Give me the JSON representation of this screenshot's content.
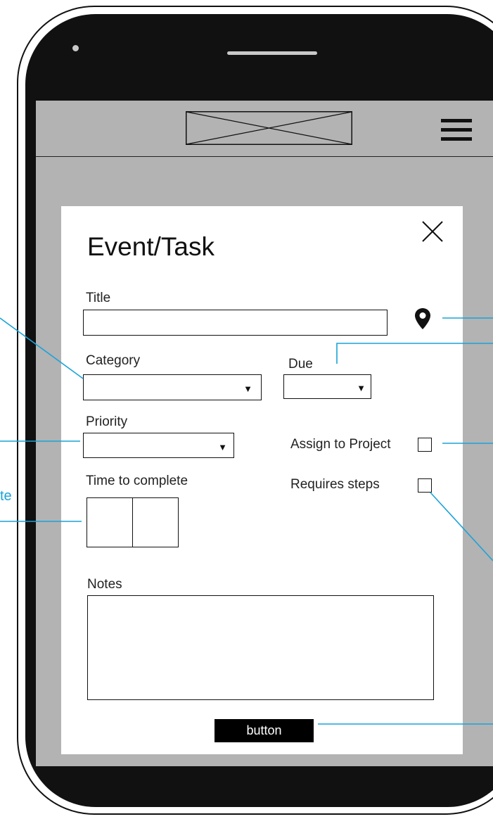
{
  "header": {
    "logo_icon": "image-placeholder-icon",
    "menu_icon": "hamburger-menu-icon"
  },
  "modal": {
    "title": "Event/Task",
    "close_icon": "close-icon",
    "fields": {
      "title_label": "Title",
      "title_value": "",
      "location_icon": "map-pin-icon",
      "category_label": "Category",
      "category_value": "",
      "due_label": "Due",
      "due_value": "",
      "priority_label": "Priority",
      "priority_value": "",
      "assign_project_label": "Assign to Project",
      "assign_project_checked": false,
      "time_label": "Time to complete",
      "requires_steps_label": "Requires steps",
      "requires_steps_checked": false,
      "notes_label": "Notes",
      "notes_value": ""
    },
    "dropdown_arrow": "▼",
    "button_label": "button"
  },
  "annotations": {
    "partial_text": "te",
    "color": "#1aa3d9"
  },
  "colors": {
    "phone_body": "#111111",
    "screen_bg": "#b3b3b3",
    "modal_bg": "#ffffff",
    "button_bg": "#000000"
  }
}
